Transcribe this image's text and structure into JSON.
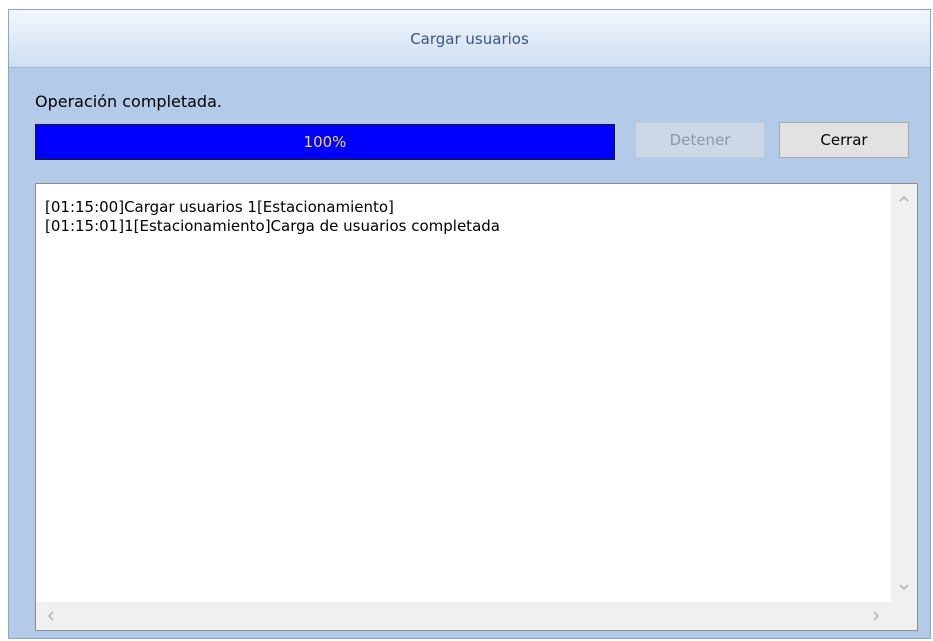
{
  "window": {
    "title": "Cargar usuarios"
  },
  "status": {
    "text": "Operación completada."
  },
  "progress": {
    "value": 1.0,
    "label": "100%",
    "color": "#0000ff",
    "label_color": "#f2d86a"
  },
  "buttons": {
    "stop_label": "Detener",
    "close_label": "Cerrar"
  },
  "log": {
    "lines": [
      "[01:15:00]Cargar usuarios 1[Estacionamiento]",
      "[01:15:01]1[Estacionamiento]Carga de usuarios completada"
    ]
  },
  "icons": {
    "scroll_up": "chevron-up-icon",
    "scroll_down": "chevron-down-icon",
    "scroll_left": "chevron-left-icon",
    "scroll_right": "chevron-right-icon"
  }
}
